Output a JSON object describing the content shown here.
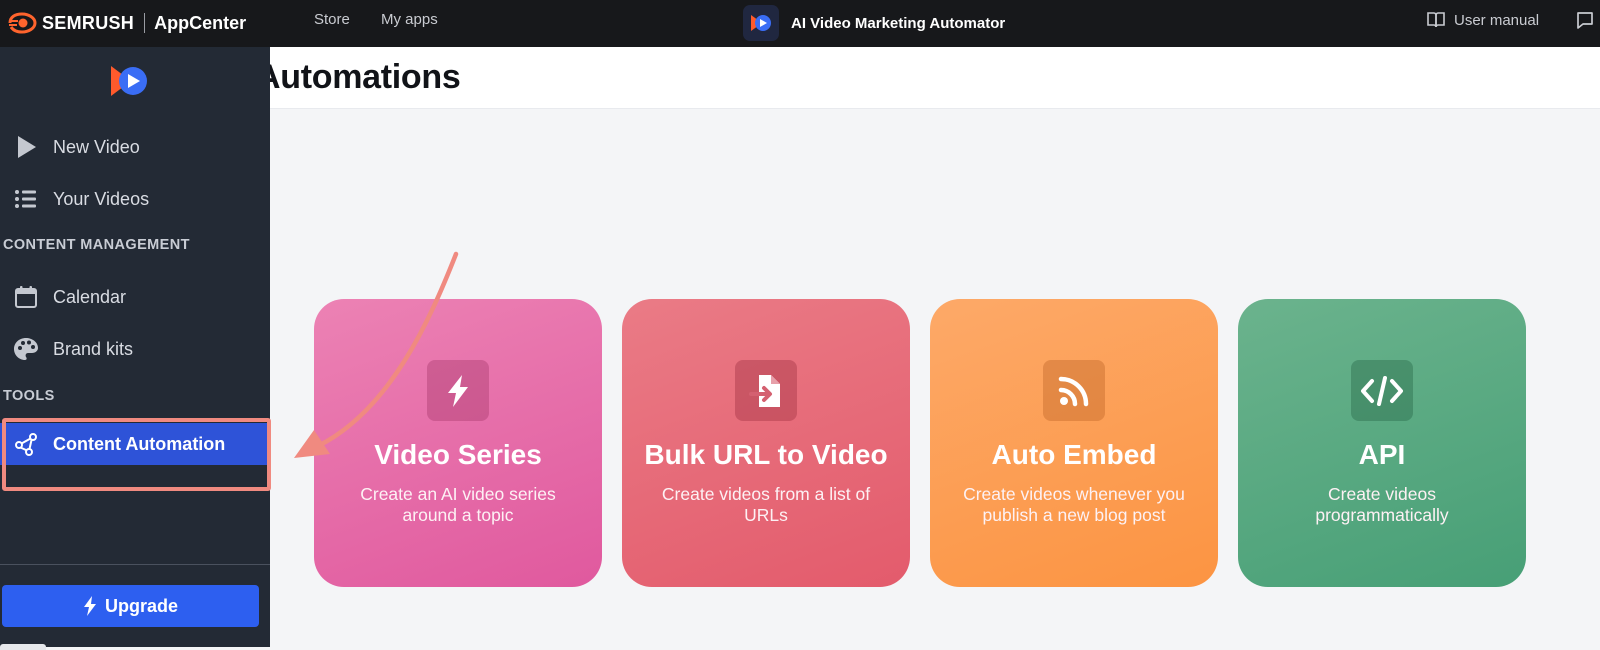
{
  "topbar": {
    "brand_name": "SEMRUSH",
    "appcenter_label": "AppCenter",
    "nav": [
      {
        "label": "Store"
      },
      {
        "label": "My apps"
      }
    ],
    "app_title": "AI Video Marketing Automator",
    "user_manual_label": "User manual"
  },
  "sidebar": {
    "items": [
      {
        "label": "New Video",
        "icon": "play-icon"
      },
      {
        "label": "Your Videos",
        "icon": "list-icon"
      }
    ],
    "content_management_heading": "CONTENT MANAGEMENT",
    "content_management_items": [
      {
        "label": "Calendar",
        "icon": "calendar-icon"
      },
      {
        "label": "Brand kits",
        "icon": "palette-icon"
      }
    ],
    "tools_heading": "TOOLS",
    "tools_items": [
      {
        "label": "Content Automation",
        "icon": "automation-icon",
        "active": true
      }
    ],
    "upgrade_label": "Upgrade"
  },
  "main": {
    "title": "Automations",
    "cards": [
      {
        "title": "Video Series",
        "description": "Create an AI video series around a topic",
        "icon": "bolt-icon",
        "color": "#e46aa6"
      },
      {
        "title": "Bulk URL to Video",
        "description": "Create videos from a list of URLs",
        "icon": "file-import-icon",
        "color": "#e66a78"
      },
      {
        "title": "Auto Embed",
        "description": "Create videos whenever you publish a new blog post",
        "icon": "rss-icon",
        "color": "#fd9f55"
      },
      {
        "title": "API",
        "description": "Create videos programmatically",
        "icon": "code-icon",
        "color": "#58a981"
      }
    ]
  },
  "colors": {
    "topbar_bg": "#17181b",
    "sidebar_bg": "#232a35",
    "active_item": "#2e53d8",
    "upgrade_button": "#2d5ff0",
    "annotation": "#f08a80",
    "brand_orange": "#ff642d"
  }
}
